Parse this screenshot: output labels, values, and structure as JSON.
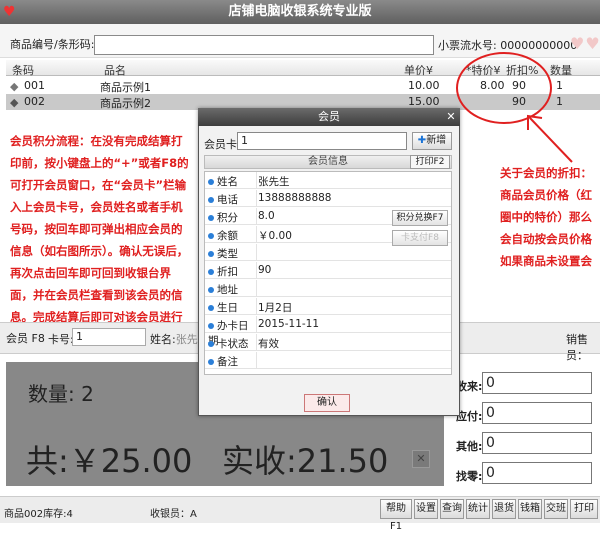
{
  "app": {
    "title": "店铺电脑收银系统专业版",
    "logo_icon": "heart-logo-icon"
  },
  "search": {
    "label": "商品编号/条形码:",
    "value": "",
    "ticket_label": "小票流水号: 00000000000"
  },
  "table": {
    "headers": [
      "条码",
      "品名",
      "单价¥",
      "*特价¥",
      "折扣%",
      "数量"
    ],
    "rows": [
      {
        "code": "001",
        "name": "商品示例1",
        "price": "10.00",
        "special": "8.00",
        "discount": "90",
        "qty": "1"
      },
      {
        "code": "002",
        "name": "商品示例2",
        "price": "15.00",
        "special": "",
        "discount": "90",
        "qty": "1"
      }
    ]
  },
  "annotations": {
    "left": "会员积分流程：在没有完成结算打印前，按小键盘上的“+”或者F8的可打开会员窗口，在“会员卡”栏输入上会员卡号，会员姓名或者手机号码，按回车即可弹出相应会员的信息（如右图所示）。确认无误后，再次点击回车即可回到收银台界面，并在会员栏查看到该会员的信息。完成结算后即可对该会员进行积分。",
    "right": "关于会员的折扣：商品会员价格（红圈中的特价）那么会自动按会员价格如果商品未设置会员价自动按会员卡折扣计"
  },
  "member_bar": {
    "tab": "会员 F8",
    "card_label": "卡号:",
    "card_value": "1",
    "name_label": "姓名:",
    "name_value": "张先",
    "sales_label": "销售员："
  },
  "summary": {
    "qty": "数量: 2",
    "total": "共:￥25.00",
    "paid": "实收:21.50"
  },
  "pay": {
    "labels": [
      "收来:",
      "应付:",
      "其他:",
      "找零:"
    ],
    "values": [
      "0",
      "0",
      "0",
      "0"
    ]
  },
  "status": {
    "left": "商品002库存:4",
    "cashier": "收银员：A"
  },
  "function_buttons": [
    "帮助F1",
    "设置",
    "查询",
    "统计",
    "退货",
    "钱箱",
    "交班",
    "打印"
  ],
  "dialog": {
    "title": "会员",
    "card_label": "会员卡:",
    "card_value": "1",
    "add_label": "新增",
    "info_header": "会员信息",
    "print_label": "打印F2",
    "fields": [
      {
        "label": "姓名",
        "value": "张先生"
      },
      {
        "label": "电话",
        "value": "13888888888"
      },
      {
        "label": "积分",
        "value": "8.0"
      },
      {
        "label": "余额",
        "value": "￥0.00"
      },
      {
        "label": "类型",
        "value": ""
      },
      {
        "label": "折扣",
        "value": "90"
      },
      {
        "label": "地址",
        "value": ""
      },
      {
        "label": "生日",
        "value": "1月2日"
      },
      {
        "label": "办卡日期",
        "value": "2015-11-11"
      },
      {
        "label": "卡状态",
        "value": "有效"
      },
      {
        "label": "备注",
        "value": ""
      }
    ],
    "redeem_label": "积分兑换F7",
    "pay_label": "卡支付F8",
    "ok_label": "确认"
  }
}
